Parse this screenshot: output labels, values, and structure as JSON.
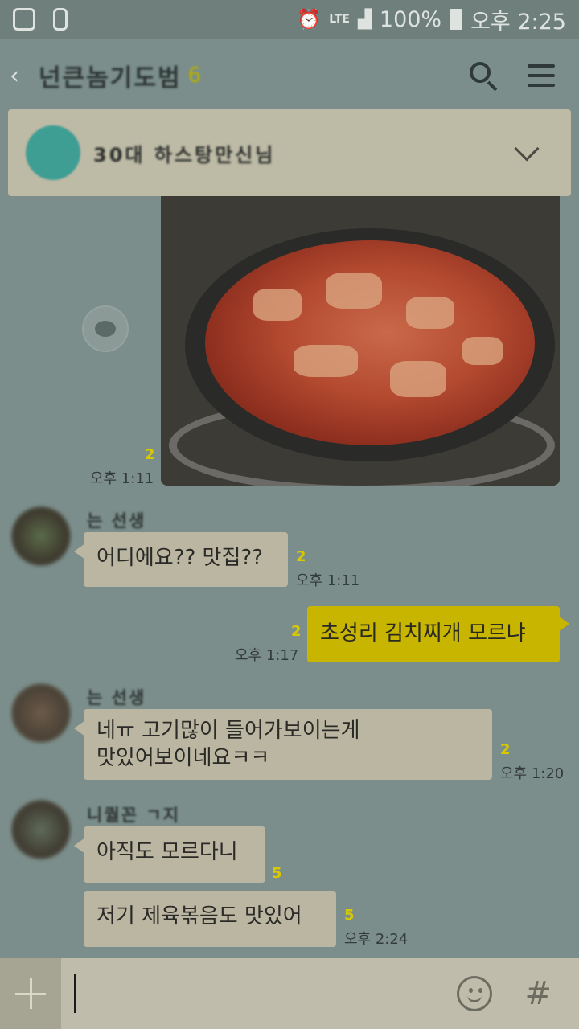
{
  "status_bar": {
    "network": "LTE",
    "battery": "100%",
    "time": "오후 2:25"
  },
  "header": {
    "back_glyph": "‹",
    "chat_title": "넌큰놈기도범",
    "title_badge": "6"
  },
  "notice": {
    "text": "30대 하스탕만신님"
  },
  "messages": {
    "photo_unread": "2",
    "photo_time": "오후 1:11",
    "m1": {
      "sender": "는 선생",
      "text": "어디에요?? 맛집??",
      "unread": "2",
      "time": "오후 1:11"
    },
    "m2": {
      "text": "초성리 김치찌개 모르냐",
      "unread": "2",
      "time": "오후 1:17"
    },
    "m3": {
      "sender": "는 선생",
      "line1": "네ㅠ 고기많이 들어가보이는게",
      "line2": "맛있어보이네요ㅋㅋ",
      "unread": "2",
      "time": "오후 1:20"
    },
    "m4": {
      "sender": "니퀄꼰 ㄱ지",
      "text": "아직도 모르다니",
      "unread": "5"
    },
    "m5": {
      "text": "저기 제육볶음도 맛있어",
      "unread": "5",
      "time": "오후 2:24"
    }
  },
  "input": {
    "placeholder": "",
    "hash": "#"
  },
  "colors": {
    "background": "#7b8e8b",
    "incoming_bubble": "#bab6a2",
    "outgoing_bubble": "#c8b500",
    "unread_count": "#d8c800"
  }
}
